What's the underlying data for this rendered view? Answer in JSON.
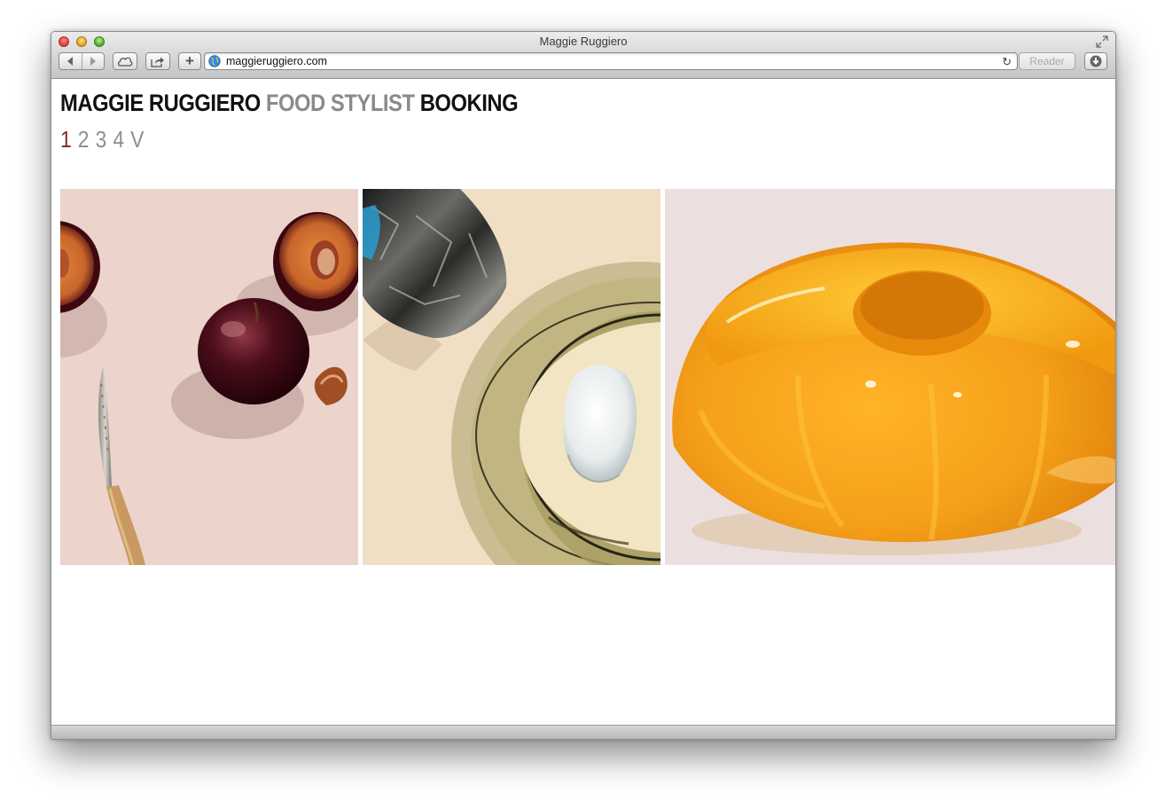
{
  "browser": {
    "window_title": "Maggie Ruggiero",
    "url": "maggieruggiero.com",
    "reader_label": "Reader",
    "plus_label": "+"
  },
  "site": {
    "title_parts": [
      {
        "text": "MAGGIE RUGGIERO",
        "tone": "black"
      },
      {
        "text": "FOOD",
        "tone": "gray"
      },
      {
        "text": "STYLIST",
        "tone": "gray"
      },
      {
        "text": "BOOKING",
        "tone": "black"
      }
    ],
    "pages": [
      "1",
      "2",
      "3",
      "4",
      "V"
    ],
    "active_page": "1"
  },
  "gallery": [
    {
      "subject": "plums and knife on pink background",
      "background": "#ecd3cc"
    },
    {
      "subject": "foil-wrapped item and glass plate with white scoop",
      "background": "#f1dfc5"
    },
    {
      "subject": "orange gelatin bundt mold",
      "background": "#ecdfe0"
    }
  ],
  "colors": {
    "active_page": "#8c2a2a",
    "inactive_text": "#8a8a8a",
    "gelatin": "#f5a31a"
  }
}
